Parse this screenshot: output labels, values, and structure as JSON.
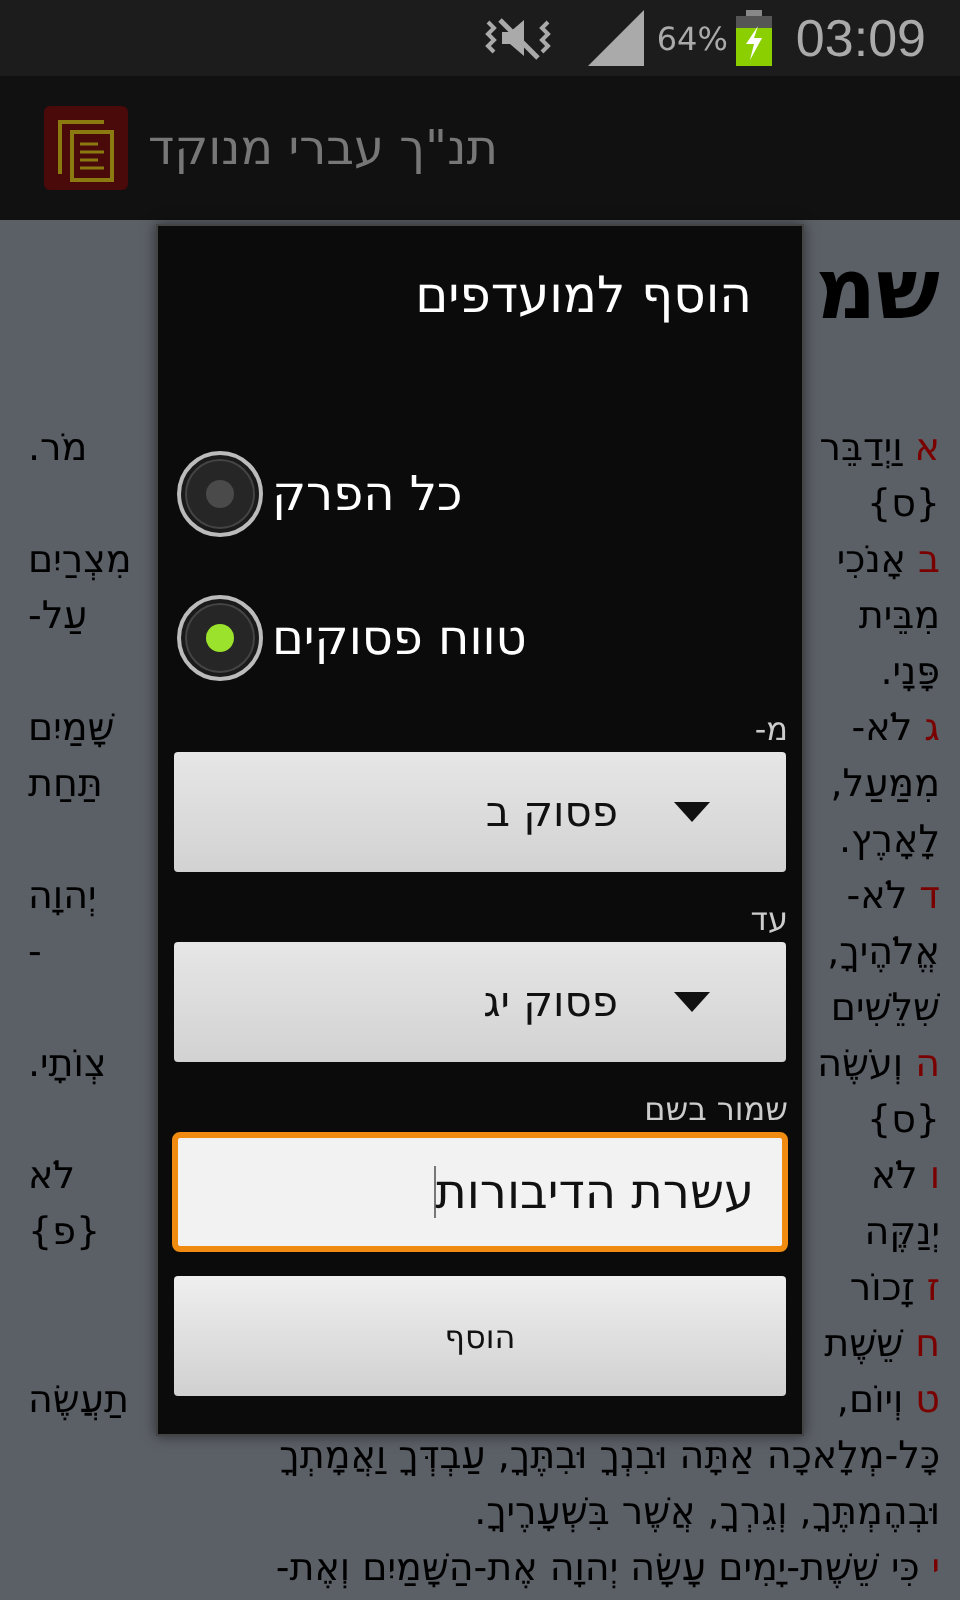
{
  "status_bar": {
    "battery": "64%",
    "time": "03:09"
  },
  "action_bar": {
    "title": "תנ\"ך עברי מנוקד"
  },
  "chapter": {
    "heading": "שמ",
    "lines": [
      {
        "number": "א",
        "right": "וַיְדַבֵּר",
        "left": "מֹר."
      },
      {
        "right": "{ס}"
      },
      {
        "number": "ב",
        "right": "אָנֹכִי",
        "left": "מִצְרַיִם"
      },
      {
        "right": "מִבֵּית",
        "left": "עַל-"
      },
      {
        "right": "פָּנָי."
      },
      {
        "number": "ג",
        "right": "לֹא-",
        "left": "שָּׁמַיִם"
      },
      {
        "right": "מִמַּעַל,",
        "left": "תַּחַת"
      },
      {
        "right": "לָאָרֶץ."
      },
      {
        "number": "ד",
        "right": "לֹא-",
        "left": "יְהוָה"
      },
      {
        "right": "אֱלֹהֶיךָ,",
        "left": "-"
      },
      {
        "right": "שִׁלֵּשִׁים"
      },
      {
        "number": "ה",
        "right": "וְעֹשֶׂה",
        "left": "צְוֺתָי."
      },
      {
        "right": "{ס}"
      },
      {
        "number": "ו",
        "right": "לֹא",
        "left": "לֹא"
      },
      {
        "right": "יְנַקֶּה",
        "left": "{פ}"
      },
      {
        "number": "ז",
        "right": "זָכוֹר"
      },
      {
        "number": "ח",
        "right": "שֵׁשֶׁת"
      },
      {
        "number": "ט",
        "right": "וְיוֹם,",
        "left": "תַעֲשֶׂה"
      }
    ],
    "full_lines": [
      {
        "text": "כָּל-מְלָאכָה אַתָּה וּבִנְךָ וּבִתֶּךָ, עַבְדְּךָ וַאֲמָתְךָ"
      },
      {
        "text": "וּבְהֶמְתֶּךָ, וְגֵרְךָ, אֲשֶׁר בִּשְׁעָרֶיךָ."
      },
      {
        "number": "י",
        "text": "כִּי שֵׁשֶׁת-יָמִים עָשָׂה יְהוָה אֶת-הַשָּׁמַיִם וְאֶת-"
      }
    ]
  },
  "dialog": {
    "title": "הוסף למועדפים",
    "options": [
      {
        "label": "כל הפרק",
        "selected": false
      },
      {
        "label": "טווח פסוקים",
        "selected": true
      }
    ],
    "from_label": "מ-",
    "from_value": "פסוק ב",
    "to_label": "עד",
    "to_value": "פסוק יג",
    "name_label": "שמור בשם",
    "name_value": "עשרת הדיבורות",
    "add_button": "הוסף"
  }
}
